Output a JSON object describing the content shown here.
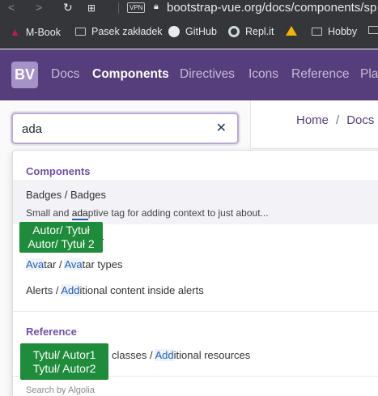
{
  "browser": {
    "vpn_label": "VPN",
    "url": "bootstrap-vue.org/docs/components/sp"
  },
  "bookmarks": [
    {
      "label": "M-Book",
      "icon": "mbook-icon"
    },
    {
      "label": "Pasek zakładek",
      "icon": "folder-icon"
    },
    {
      "label": "GitHub",
      "icon": "github-icon"
    },
    {
      "label": "Repl.it",
      "icon": "replit-icon"
    },
    {
      "label": "",
      "icon": "google-drive-icon"
    },
    {
      "label": "Hobby",
      "icon": "folder-icon"
    }
  ],
  "navbar": {
    "logo": "BV",
    "links": [
      "Docs",
      "Components",
      "Directives",
      "Icons",
      "Reference",
      "Pla"
    ],
    "active": "Components"
  },
  "search": {
    "value": "ada",
    "clear_icon": "close-icon"
  },
  "breadcrumb": [
    "Home",
    "Docs"
  ],
  "dropdown": {
    "components_heading": "Components",
    "badges_item": {
      "prefix": "Badges / ",
      "title": "Badges"
    },
    "badges_desc": {
      "before": "Small and ",
      "match": "ada",
      "after": "ptive tag for adding context to just about..."
    },
    "hidden_item_tail": "r",
    "avatar_item": {
      "p1": "Ava",
      "p2": "tar / ",
      "p3": "Ava",
      "p4": "tar types"
    },
    "alerts_item": {
      "prefix": "Alerts / ",
      "match": "Add",
      "rest": "itional content inside alerts"
    },
    "reference_heading": "Reference",
    "ref_item": {
      "prefix": "classes / ",
      "match": "Add",
      "rest": "itional resources"
    },
    "footer": "Search by Algolia"
  },
  "overlays": {
    "first": [
      "Autor/ Tytuł",
      "Autor/ Tytuł 2"
    ],
    "second": [
      "Tytuł/ Autor1",
      "Tytuł/ Autor2"
    ]
  },
  "colors": {
    "navbar": "#563d7c",
    "accent": "#7050a7",
    "overlay_green": "#1e8c3a"
  }
}
